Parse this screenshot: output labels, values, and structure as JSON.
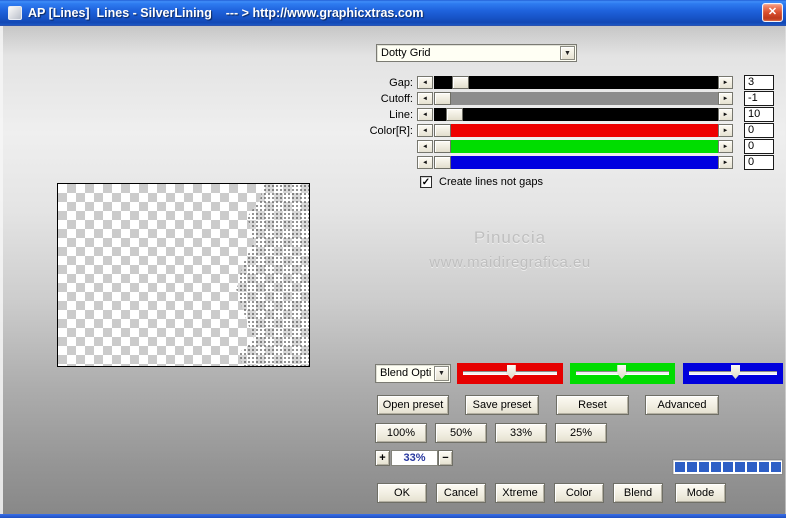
{
  "window": {
    "title": "AP [Lines]  Lines - SilverLining    --- > http://www.graphicxtras.com"
  },
  "icons": {
    "close": "✕",
    "slider_left": "◄",
    "slider_right": "►",
    "dropdown": "▼",
    "check": "✓"
  },
  "filter": {
    "preset_dropdown_value": "Dotty Grid",
    "sliders": [
      {
        "label": "Gap:",
        "value": "3",
        "track_color": "#000000",
        "thumb_pos": 0.063
      },
      {
        "label": "Cutoff:",
        "value": "-1",
        "track_color": "#8c8c8c",
        "thumb_pos": 0.0
      },
      {
        "label": "Line:",
        "value": "10",
        "track_color": "#000000",
        "thumb_pos": 0.042
      },
      {
        "label": "Color[R]:",
        "value": "0",
        "track_color": "#ee0000",
        "thumb_pos": 0.0
      },
      {
        "label": "",
        "value": "0",
        "track_color": "#00dd00",
        "thumb_pos": 0.0
      },
      {
        "label": "",
        "value": "0",
        "track_color": "#0000e0",
        "thumb_pos": 0.0
      }
    ],
    "checkbox": {
      "label": "Create lines not gaps",
      "checked": true
    }
  },
  "watermark": {
    "line1": "Pinuccia",
    "line2": "www.maidiregrafica.eu"
  },
  "blend": {
    "dropdown_value": "Blend Opti",
    "channels": [
      {
        "name": "red",
        "color": "#e60000",
        "thumb_pos": 0.47
      },
      {
        "name": "green",
        "color": "#00dc00",
        "thumb_pos": 0.45
      },
      {
        "name": "blue",
        "color": "#0000dc",
        "thumb_pos": 0.48
      }
    ]
  },
  "preset_buttons": [
    "Open preset",
    "Save preset",
    "Reset",
    "Advanced"
  ],
  "percent_buttons": [
    "100%",
    "50%",
    "33%",
    "25%"
  ],
  "zoom_control": {
    "plus": "+",
    "value": "33%",
    "minus": "−"
  },
  "progress": {
    "segments": 9
  },
  "action_buttons": [
    "OK",
    "Cancel",
    "Xtreme",
    "Color",
    "Blend",
    "Mode"
  ]
}
